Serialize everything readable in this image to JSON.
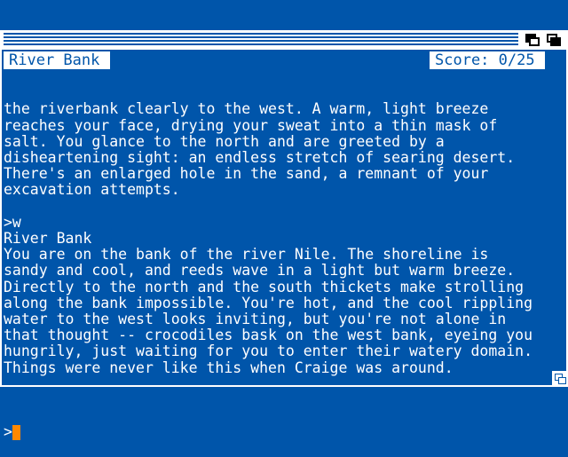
{
  "window": {
    "location": "River Bank",
    "score": "Score: 0/25"
  },
  "transcript": {
    "lines": [
      "the riverbank clearly to the west. A warm, light breeze",
      "reaches your face, drying your sweat into a thin mask of",
      "salt. You glance to the north and are greeted by a",
      "disheartening sight: an endless stretch of searing desert.",
      "There's an enlarged hole in the sand, a remnant of your",
      "excavation attempts.",
      "",
      ">w",
      "River Bank",
      "You are on the bank of the river Nile. The shoreline is",
      "sandy and cool, and reeds wave in a light but warm breeze.",
      "Directly to the north and the south thickets make strolling",
      "along the bank impossible. You're hot, and the cool rippling",
      "water to the west looks inviting, but you're not alone in",
      "that thought -- crocodiles bask on the west bank, eyeing you",
      "hungrily, just waiting for you to enter their watery domain.",
      "Things were never like this when Craige was around.",
      ""
    ],
    "prompt": ">"
  },
  "colors": {
    "background": "#0055aa",
    "text": "#ffffff",
    "cursor": "#ff8800"
  },
  "icons": {
    "depth_back": "depth-back-icon",
    "depth_front": "depth-front-icon",
    "resize": "resize-gadget-icon"
  }
}
